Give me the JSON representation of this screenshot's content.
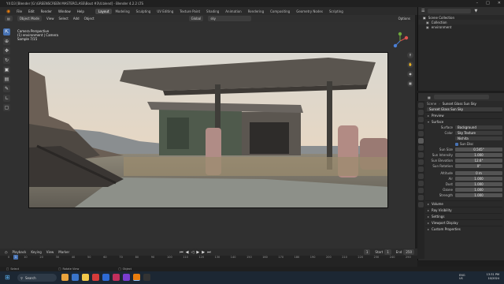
{
  "window": {
    "title": "Y4 D3 [Blender [G:\\GREENSCREEN MASTERCLASS\\Bout #3\\4.blend] - Blender 4.2.2 LTS"
  },
  "menu": {
    "items": [
      "File",
      "Edit",
      "Render",
      "Window",
      "Help"
    ],
    "workspaces": [
      "Layout",
      "Modeling",
      "Sculpting",
      "UV Editing",
      "Texture Paint",
      "Shading",
      "Animation",
      "Rendering",
      "Compositing",
      "Geometry Nodes",
      "Scripting"
    ],
    "active_workspace": "Layout",
    "scene_label": "Scene",
    "viewlayer_label": "ViewLayer"
  },
  "viewport_header": {
    "mode": "Object Mode",
    "menus": [
      "View",
      "Select",
      "Add",
      "Object"
    ],
    "transform": "Global",
    "search_value": "sky",
    "options_label": "Options"
  },
  "viewport_info": {
    "line1": "Camera Perspective",
    "line2": "(1) environment | Camera",
    "line3": "Sample 7/15"
  },
  "outliner": {
    "header": "Scene Collection",
    "rows": [
      "Scene Collection",
      "Collection",
      "environment"
    ]
  },
  "properties": {
    "breadcrumb_scene": "Scene",
    "breadcrumb_world": "Sunset Glass Sun Sky",
    "world_name": "Sunset Glass Sun Sky",
    "sections_top": [
      "Preview",
      "Surface"
    ],
    "surface_label": "Surface",
    "surface_value": "Background",
    "color_label": "Color",
    "color_value": "Sky Texture",
    "sky_type": "Nishita",
    "sun_disc_label": "Sun Disc",
    "fields": [
      {
        "label": "Sun Size",
        "value": "0.545°"
      },
      {
        "label": "Sun Intensity",
        "value": "1.000"
      },
      {
        "label": "Sun Elevation",
        "value": "12.6°"
      },
      {
        "label": "Sun Rotation",
        "value": "0°"
      },
      {
        "label": "Altitude",
        "value": "0 m"
      },
      {
        "label": "Air",
        "value": "1.000"
      },
      {
        "label": "Dust",
        "value": "1.000"
      },
      {
        "label": "Ozone",
        "value": "1.000"
      },
      {
        "label": "Strength",
        "value": "1.000"
      }
    ],
    "sections_bottom": [
      "Volume",
      "Ray Visibility",
      "Settings",
      "Viewport Display",
      "Custom Properties"
    ]
  },
  "timeline": {
    "menus": [
      "Playback",
      "Keying",
      "View",
      "Marker"
    ],
    "current_frame": "1",
    "start_label": "Start",
    "start_value": "1",
    "end_label": "End",
    "end_value": "250",
    "ticks": [
      "0",
      "10",
      "20",
      "30",
      "40",
      "50",
      "60",
      "70",
      "80",
      "90",
      "100",
      "110",
      "120",
      "130",
      "140",
      "150",
      "160",
      "170",
      "180",
      "190",
      "200",
      "210",
      "220",
      "230",
      "240",
      "250"
    ]
  },
  "statusbar": {
    "items": [
      "Select",
      "Rotate View",
      "Object"
    ]
  },
  "taskbar": {
    "search_placeholder": "Search",
    "lang": "ENG",
    "lang2": "US",
    "time": "13:31 PM",
    "date": "10/2024"
  },
  "colors": {
    "accent": "#4772b3",
    "panel": "#2a2a2a",
    "taskbar": "#1c2733"
  }
}
